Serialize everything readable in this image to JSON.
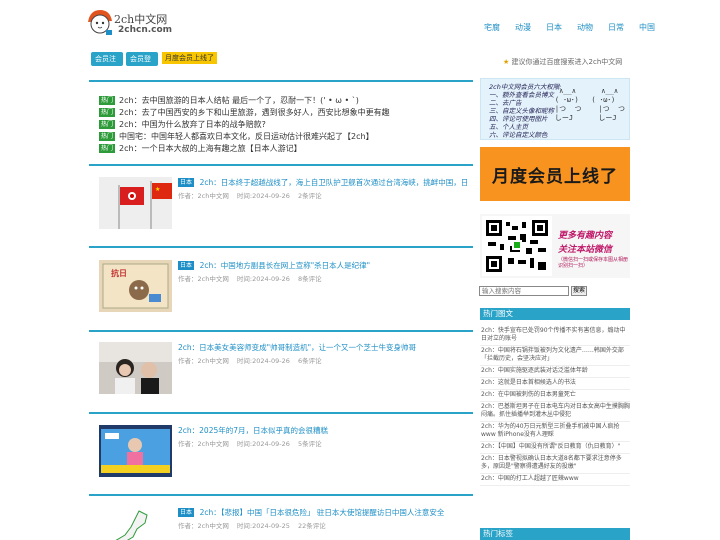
{
  "header": {
    "logo_title": "2ch中文网",
    "logo_url": "2chcn.com",
    "nav": [
      "宅腐",
      "动漫",
      "日本",
      "动物",
      "日常",
      "中国"
    ]
  },
  "toolbar": {
    "register": "会员注册",
    "login": "会员登录",
    "monthly": "月度会员上线了",
    "search_hint": "建议你通过百度搜索进入2ch中文网"
  },
  "news": [
    {
      "tag": "热门",
      "text": "2ch：去中国旅游的日本人结帖 最后一个了，忍耐一下！(' • ω • `)"
    },
    {
      "tag": "热门",
      "text": "2ch：去了中国西安的乡下和山里旅游，遇到很多好人，西安比想象中更有趣"
    },
    {
      "tag": "热门",
      "text": "2ch：中国为什么放弃了日本的战争赔款?"
    },
    {
      "tag": "热门",
      "text": "中国宅：中国年轻人都喜欢日本文化，反日运动估计很难兴起了【2ch】"
    },
    {
      "tag": "热门",
      "text": "2ch：一个日本大叔的上海有趣之旅【日本人游记】"
    }
  ],
  "articles": [
    {
      "tag": "日本",
      "title": "2ch：日本终于超越战线了，海上自卫队护卫舰首次通过台湾海峡，挑衅中国，日",
      "author": "作者：2ch中文网",
      "time": "时间:2024-09-26",
      "comments": "2条评论"
    },
    {
      "tag": "日本",
      "title": "2ch：中国地方副县长在网上宣称\"杀日本人是纪律\"",
      "author": "作者：2ch中文网",
      "time": "时间:2024-09-26",
      "comments": "8条评论"
    },
    {
      "tag": "",
      "title": "2ch：日本美女美容师变成\"帅哥制造机\"，让一个又一个芝士牛变身帅哥",
      "author": "作者：2ch中文网",
      "time": "时间:2024-09-26",
      "comments": "6条评论"
    },
    {
      "tag": "",
      "title": "2ch：2025年的7月，日本似乎真的会很糟糕",
      "author": "作者：2ch中文网",
      "time": "时间:2024-09-26",
      "comments": "5条评论"
    },
    {
      "tag": "日本",
      "title": "2ch：【悲报】中国「日本很危险」 驻日本大使馆提醒访日中国人注意安全",
      "author": "作者：2ch中文网",
      "time": "时间:2024-09-25",
      "comments": "22条评论"
    }
  ],
  "sidebar": {
    "emote_lines": [
      "2ch中文网会员六大权限:",
      "一、额外查看会员博文",
      "二、去广告",
      "三、自定义头像和昵称",
      "四、评论可使用图片",
      "五、个人主页",
      "六、评论自定义颜色"
    ],
    "emote_faces": "   ∧__∧      ∧__∧\n  ( ･ω･)   ( ･ω･)\n  |つ  つ    |つ  つ\n  しーJ      しーJ",
    "ad_text": "月度会员上线了",
    "qr_line1": "更多有趣内容",
    "qr_line2": "关注本站微信",
    "qr_line3": "（微信扫一扫或保存本图从相册识别扫一扫）",
    "search_placeholder": "输入搜索内容",
    "search_button": "搜索",
    "hot_title": "热门图文",
    "hot": [
      "2ch：快手宣布已处罚90个传播不实有害信息，煽动中日对立的账号",
      "2ch：中国将石锅拌饭被列为文化遗产……韩国外交部「拦截历史，会坚决应对」",
      "2ch：中国实施驱逐武装对话泛滥体年龄",
      "2ch：这就是日本首相候选人的书法",
      "2ch：在中国被刺伤的日本男童死亡",
      "2ch：巴基斯坦男子在日本电车内对日本女高中生摸胸胸闷痛。抓住插播举到灌木丛中侵犯",
      "2ch：华为的40万日元新型三折叠手机被中国人疯抢 www 新iPhone没有人理睬",
      "2ch：【中国】中国没有所谓\"反日教育（仇日教育）\"",
      "2ch：日本警视拟确认日本大道8名都下要求注意停多多，原因是\"警察得遭遇好友的投缴\"",
      "2ch：中国的打工人超越了匠辣www"
    ],
    "hot_tags_title": "热门标签"
  }
}
